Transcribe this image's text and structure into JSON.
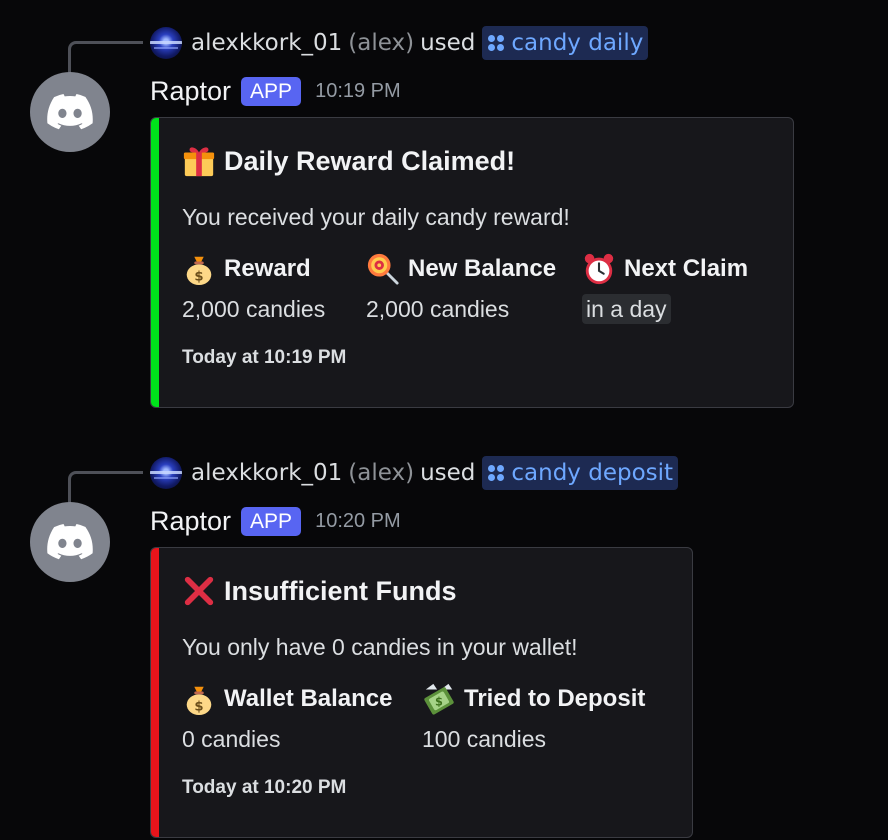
{
  "messages": [
    {
      "reply": {
        "username": "alexkkork_01",
        "nickname": "(alex)",
        "used_label": "used",
        "command": "candy daily",
        "avatar_icon": "galaxy-avatar-icon"
      },
      "author": {
        "name": "Raptor",
        "badge": "APP",
        "time": "10:19 PM",
        "avatar_icon": "discord-logo-icon"
      },
      "embed": {
        "accent_color": "#00e31b",
        "title_emoji": "gift-icon",
        "title": "Daily Reward Claimed!",
        "description": "You received your daily candy reward!",
        "fields": [
          {
            "emoji": "money-bag-icon",
            "name": "Reward",
            "value": "2,000 candies"
          },
          {
            "emoji": "lollipop-icon",
            "name": "New Balance",
            "value": "2,000 candies"
          },
          {
            "emoji": "alarm-clock-icon",
            "name": "Next Claim",
            "value": "in a day"
          }
        ],
        "footer": "Today at 10:19 PM"
      }
    },
    {
      "reply": {
        "username": "alexkkork_01",
        "nickname": "(alex)",
        "used_label": "used",
        "command": "candy deposit",
        "avatar_icon": "galaxy-avatar-icon"
      },
      "author": {
        "name": "Raptor",
        "badge": "APP",
        "time": "10:20 PM",
        "avatar_icon": "discord-logo-icon"
      },
      "embed": {
        "accent_color": "#e7141b",
        "title_emoji": "cross-mark-icon",
        "title": "Insufficient Funds",
        "description": "You only have 0 candies in your wallet!",
        "fields": [
          {
            "emoji": "money-bag-icon",
            "name": "Wallet Balance",
            "value": "0 candies"
          },
          {
            "emoji": "money-with-wings-icon",
            "name": "Tried to Deposit",
            "value": "100 candies"
          }
        ],
        "footer": "Today at 10:20 PM"
      }
    }
  ],
  "colors": {
    "background": "#070709",
    "embed_background": "#17171b",
    "app_badge": "#5865f2",
    "command_text": "#6ea8ff",
    "avatar": "#80848e"
  }
}
